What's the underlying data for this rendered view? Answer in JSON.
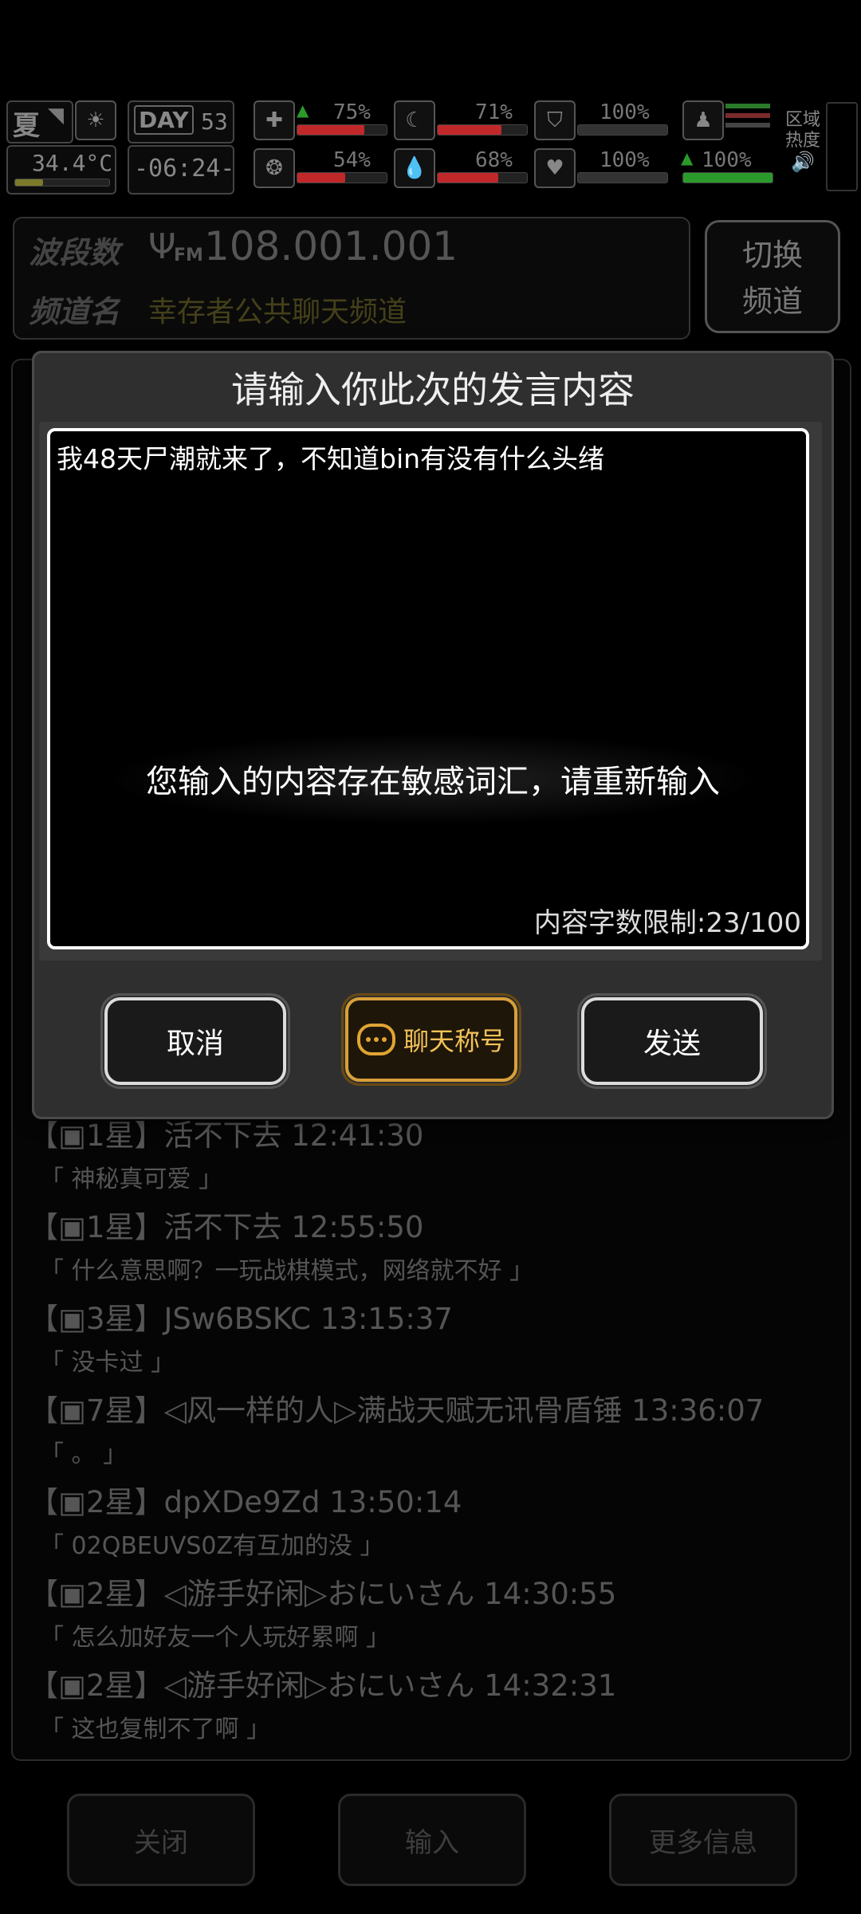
{
  "status": {
    "season": "夏",
    "temperature": "34.4°C",
    "day_label": "DAY",
    "day_number": "53",
    "time": "-06:24-",
    "stat1_pct": "75%",
    "stat2_pct": "71%",
    "stat3_pct": "100%",
    "stat4_pct": "54%",
    "stat5_pct": "68%",
    "stat6_pct": "100%",
    "stat7_pct": "100%",
    "zone_label_1": "区域",
    "zone_label_2": "热度"
  },
  "frequency": {
    "band_label": "波段数",
    "band_value": "108.001.001",
    "fm_label": "FM",
    "channel_label": "频道名",
    "channel_value": "幸存者公共聊天频道",
    "switch_line1": "切换",
    "switch_line2": "频道"
  },
  "messages": [
    {
      "header": "【▣1星】活不下去 12:41:30",
      "body": "「 神秘真可爱 」"
    },
    {
      "header": "【▣1星】活不下去 12:55:50",
      "body": "「 什么意思啊？一玩战棋模式，网络就不好 」"
    },
    {
      "header": "【▣3星】JSw6BSKC 13:15:37",
      "body": "「 没卡过 」"
    },
    {
      "header": "【▣7星】◁风一样的人▷满战天赋无讯骨盾锤 13:36:07",
      "body": "「 。 」"
    },
    {
      "header": "【▣2星】dpXDe9Zd 13:50:14",
      "body": "「 02QBEUVS0Z有互加的没 」"
    },
    {
      "header": "【▣2星】◁游手好闲▷おにいさん 14:30:55",
      "body": "「 怎么加好友一个人玩好累啊 」"
    },
    {
      "header": "【▣2星】◁游手好闲▷おにいさん 14:32:31",
      "body": "「 这也复制不了啊 」"
    }
  ],
  "bottom_buttons": {
    "close": "关闭",
    "input": "输入",
    "more_info": "更多信息"
  },
  "dialog": {
    "title": "请输入你此次的发言内容",
    "input_text": "我48天尸潮就来了，不知道bin有没有什么头绪",
    "toast": "您输入的内容存在敏感词汇，请重新输入",
    "counter": "内容字数限制:23/100",
    "cancel": "取消",
    "chat_title": "聊天称号",
    "send": "发送"
  },
  "colors": {
    "accent_gold": "#d8a03a",
    "bar_red": "#c0282a",
    "bar_green": "#2a9a2a"
  }
}
